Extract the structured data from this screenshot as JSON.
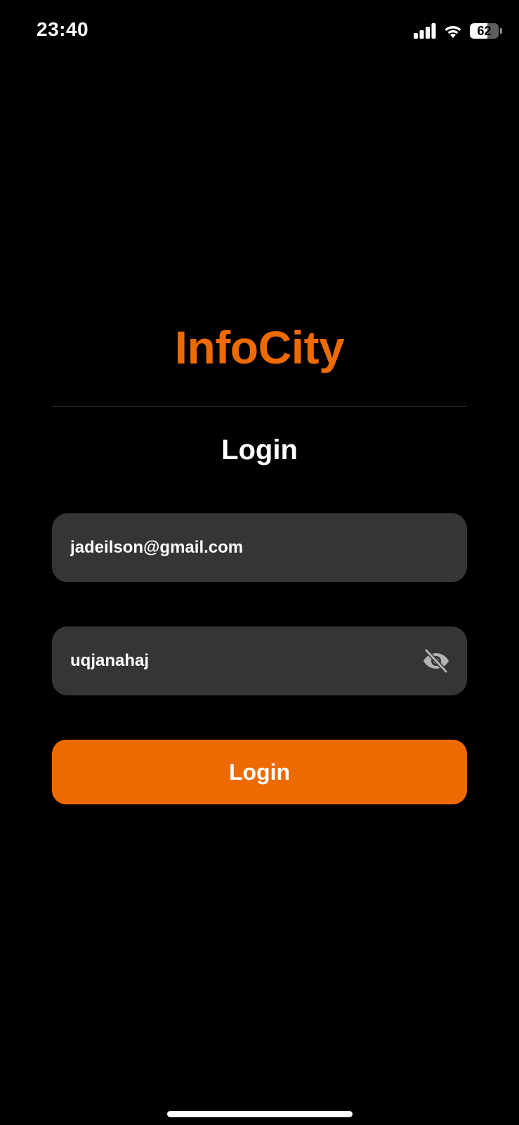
{
  "status_bar": {
    "time": "23:40",
    "battery_level": "62",
    "icons": [
      "signal-icon",
      "wifi-icon",
      "battery-icon"
    ]
  },
  "app": {
    "brand": "InfoCity",
    "brand_color": "#ec6a00"
  },
  "login": {
    "title": "Login",
    "email_value": "jadeilson@gmail.com",
    "password_value": "uqjanahaj",
    "password_toggle_icon": "eye-slash-icon",
    "submit_label": "Login"
  },
  "colors": {
    "background": "#000000",
    "field_background": "#353535",
    "accent": "#ec6a00"
  }
}
